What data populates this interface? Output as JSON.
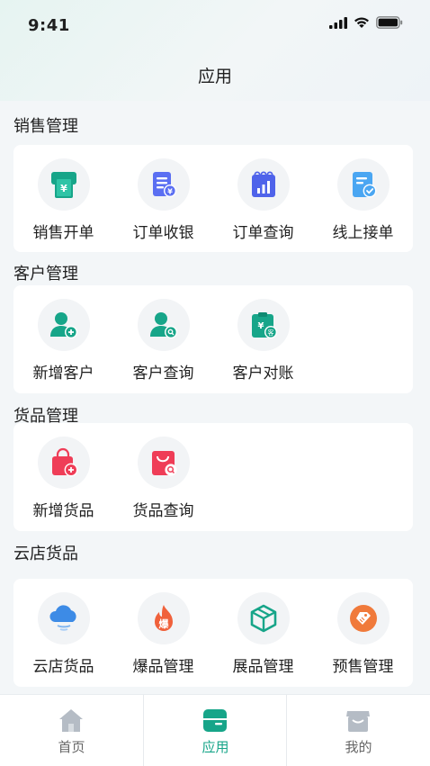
{
  "status": {
    "time": "9:41"
  },
  "nav": {
    "title": "应用"
  },
  "sections": {
    "sales": {
      "title": "销售管理",
      "items": [
        "销售开单",
        "订单收银",
        "订单查询",
        "线上接单"
      ]
    },
    "customer": {
      "title": "客户管理",
      "items": [
        "新增客户",
        "客户查询",
        "客户对账"
      ]
    },
    "goods": {
      "title": "货品管理",
      "items": [
        "新增货品",
        "货品查询"
      ]
    },
    "cloud": {
      "title": "云店货品",
      "items": [
        "云店货品",
        "爆品管理",
        "展品管理",
        "预售管理"
      ]
    }
  },
  "icons": {
    "sales": [
      "cashier-ticket-icon",
      "invoice-cash-icon",
      "calendar-chart-icon",
      "tablet-check-icon"
    ],
    "customer": [
      "add-user-icon",
      "search-user-icon",
      "clipboard-reconcile-icon"
    ],
    "goods": [
      "shopping-bag-add-icon",
      "bag-search-icon"
    ],
    "cloud": [
      "cloud-icon",
      "flame-icon",
      "box-icon",
      "tag-icon"
    ]
  },
  "tabs": [
    {
      "label": "首页",
      "icon": "home-icon",
      "active": false
    },
    {
      "label": "应用",
      "icon": "apps-inbox-icon",
      "active": true
    },
    {
      "label": "我的",
      "icon": "store-icon",
      "active": false
    }
  ],
  "colors": {
    "accent": "#17a589",
    "blue": "#5b6ff2",
    "sky": "#4aa6f2",
    "red": "#ef3d57",
    "orange": "#f07a3b"
  }
}
